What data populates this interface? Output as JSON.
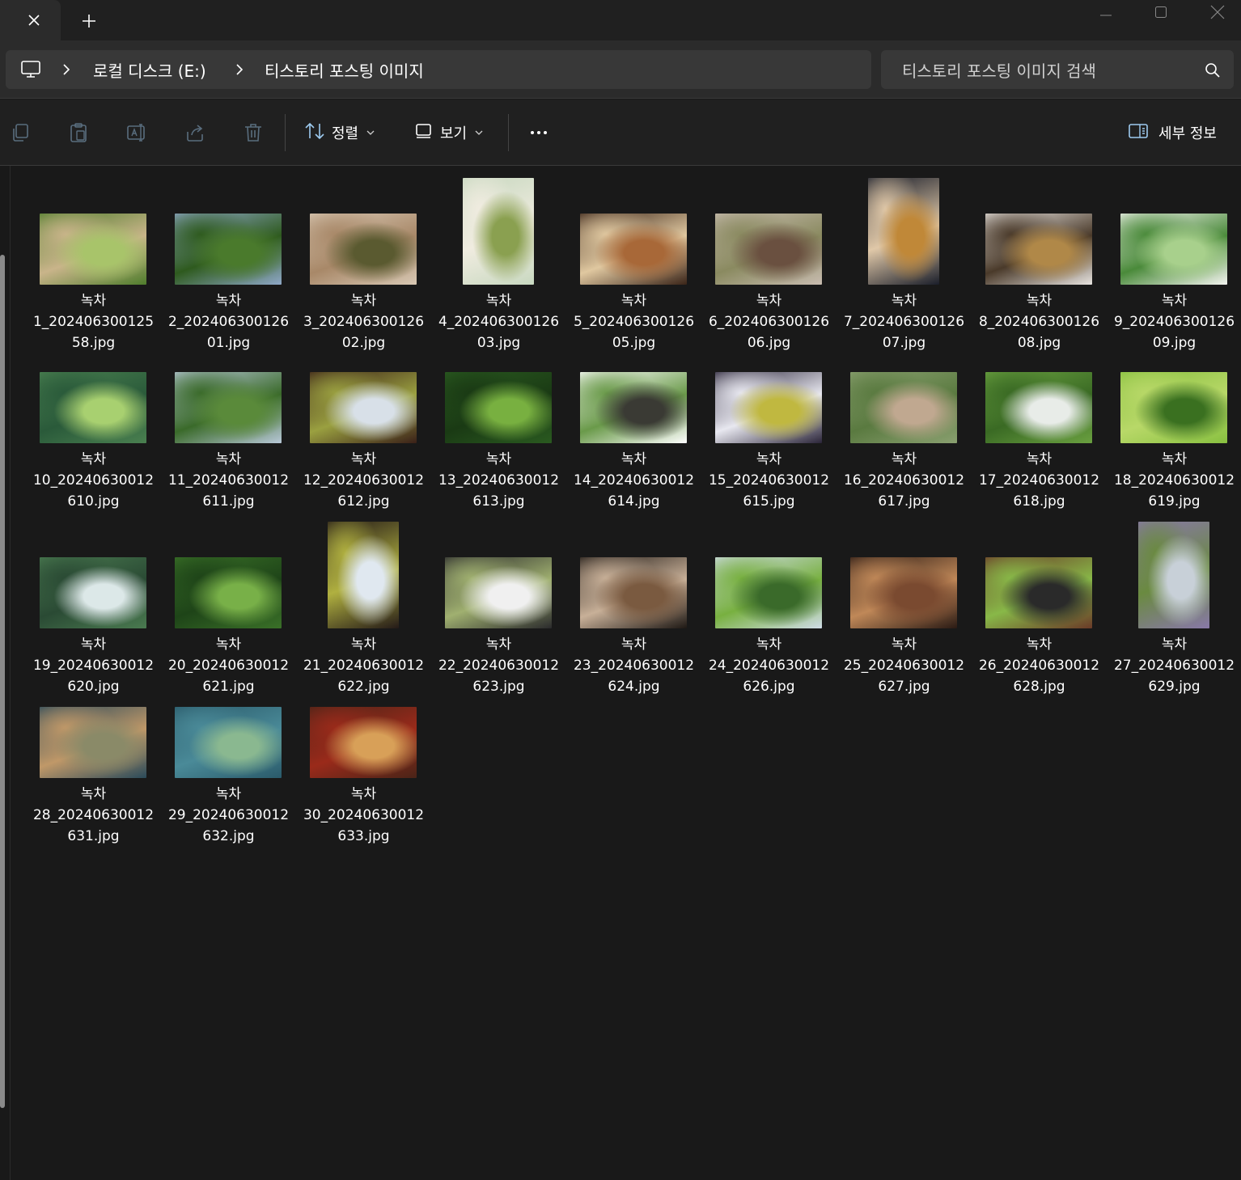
{
  "window": {
    "tab_close_icon": "close-icon",
    "new_tab_icon": "plus-icon",
    "controls": [
      "minimize-icon",
      "maximize-icon",
      "close-icon"
    ]
  },
  "address": {
    "pc_icon": "computer-icon",
    "crumbs": [
      "로컬 디스크 (E:)",
      "티스토리 포스팅 이미지"
    ]
  },
  "search": {
    "placeholder": "티스토리 포스팅 이미지 검색",
    "icon": "search-icon"
  },
  "toolbar": {
    "icons": [
      "copy-icon",
      "paste-icon",
      "rename-icon",
      "share-icon",
      "delete-icon"
    ],
    "sort_label": "정렬",
    "view_label": "보기",
    "more_icon": "more-icon",
    "details_label": "세부 정보"
  },
  "files": [
    {
      "title": "녹차",
      "line1": "1_202406300125",
      "line2": "58.jpg",
      "colors": [
        "#4f7d2c",
        "#a8c46a",
        "#c9b48a"
      ],
      "orient": "landscape"
    },
    {
      "title": "녹차",
      "line1": "2_202406300126",
      "line2": "01.jpg",
      "colors": [
        "#8fa8c8",
        "#4a7a2c",
        "#2e5a1e"
      ],
      "orient": "landscape"
    },
    {
      "title": "녹차",
      "line1": "3_202406300126",
      "line2": "02.jpg",
      "colors": [
        "#d8c8b4",
        "#5a5a30",
        "#a88868"
      ],
      "orient": "landscape"
    },
    {
      "title": "녹차",
      "line1": "4_202406300126",
      "line2": "03.jpg",
      "colors": [
        "#c8d8c0",
        "#8aa050",
        "#f0ece0"
      ],
      "orient": "portrait"
    },
    {
      "title": "녹차",
      "line1": "5_202406300126",
      "line2": "05.jpg",
      "colors": [
        "#3a2418",
        "#a86838",
        "#e0c8a0"
      ],
      "orient": "landscape"
    },
    {
      "title": "녹차",
      "line1": "6_202406300126",
      "line2": "06.jpg",
      "colors": [
        "#c8bcb0",
        "#6a5040",
        "#8a8a60"
      ],
      "orient": "landscape"
    },
    {
      "title": "녹차",
      "line1": "7_202406300126",
      "line2": "07.jpg",
      "colors": [
        "#1a1e2a",
        "#c08838",
        "#e0c8a8"
      ],
      "orient": "portrait"
    },
    {
      "title": "녹차",
      "line1": "8_202406300126",
      "line2": "08.jpg",
      "colors": [
        "#e8e4e0",
        "#b08848",
        "#4a3a2a"
      ],
      "orient": "landscape"
    },
    {
      "title": "녹차",
      "line1": "9_202406300126",
      "line2": "09.jpg",
      "colors": [
        "#f4f4f0",
        "#a8d08c",
        "#4a8a3a"
      ],
      "orient": "landscape"
    },
    {
      "title": "녹차",
      "line1": "10_20240630012",
      "line2": "610.jpg",
      "colors": [
        "#4a8050",
        "#a8d070",
        "#2a5a3a"
      ],
      "orient": "landscape"
    },
    {
      "title": "녹차",
      "line1": "11_20240630012",
      "line2": "611.jpg",
      "colors": [
        "#b8c8d8",
        "#5a8a3a",
        "#3a6a2a"
      ],
      "orient": "landscape"
    },
    {
      "title": "녹차",
      "line1": "12_20240630012",
      "line2": "612.jpg",
      "colors": [
        "#3a2018",
        "#d8e0e8",
        "#9aa040"
      ],
      "orient": "landscape"
    },
    {
      "title": "녹차",
      "line1": "13_20240630012",
      "line2": "613.jpg",
      "colors": [
        "#2a5a20",
        "#78b040",
        "#1a3a14"
      ],
      "orient": "landscape"
    },
    {
      "title": "녹차",
      "line1": "14_20240630012",
      "line2": "614.jpg",
      "colors": [
        "#ffffff",
        "#3a3a34",
        "#6a9a4a"
      ],
      "orient": "landscape"
    },
    {
      "title": "녹차",
      "line1": "15_20240630012",
      "line2": "615.jpg",
      "colors": [
        "#2a2438",
        "#c0b840",
        "#e8e8f0"
      ],
      "orient": "landscape"
    },
    {
      "title": "녹차",
      "line1": "16_20240630012",
      "line2": "617.jpg",
      "colors": [
        "#8aa070",
        "#c0a890",
        "#5a7a40"
      ],
      "orient": "landscape"
    },
    {
      "title": "녹차",
      "line1": "17_20240630012",
      "line2": "618.jpg",
      "colors": [
        "#6aa040",
        "#e8ece8",
        "#3a6a24"
      ],
      "orient": "landscape"
    },
    {
      "title": "녹차",
      "line1": "18_20240630012",
      "line2": "619.jpg",
      "colors": [
        "#88c040",
        "#3a7020",
        "#b8d868"
      ],
      "orient": "landscape"
    },
    {
      "title": "녹차",
      "line1": "19_20240630012",
      "line2": "620.jpg",
      "colors": [
        "#4a7a50",
        "#dce8e8",
        "#2a4a34"
      ],
      "orient": "landscape"
    },
    {
      "title": "녹차",
      "line1": "20_20240630012",
      "line2": "621.jpg",
      "colors": [
        "#3a7028",
        "#78b048",
        "#1e4418"
      ],
      "orient": "landscape"
    },
    {
      "title": "녹차",
      "line1": "21_20240630012",
      "line2": "622.jpg",
      "colors": [
        "#241a18",
        "#e0e8f0",
        "#b0b040"
      ],
      "orient": "portrait"
    },
    {
      "title": "녹차",
      "line1": "22_20240630012",
      "line2": "623.jpg",
      "colors": [
        "#2a2a2c",
        "#f0f0f0",
        "#a0b070"
      ],
      "orient": "landscape"
    },
    {
      "title": "녹차",
      "line1": "23_20240630012",
      "line2": "624.jpg",
      "colors": [
        "#1e1814",
        "#7a5a40",
        "#c8b098"
      ],
      "orient": "landscape"
    },
    {
      "title": "녹차",
      "line1": "24_20240630012",
      "line2": "626.jpg",
      "colors": [
        "#d0dce8",
        "#3a6a2a",
        "#78b040"
      ],
      "orient": "landscape"
    },
    {
      "title": "녹차",
      "line1": "25_20240630012",
      "line2": "627.jpg",
      "colors": [
        "#2a1a14",
        "#7a4a30",
        "#c08858"
      ],
      "orient": "landscape"
    },
    {
      "title": "녹차",
      "line1": "26_20240630012",
      "line2": "628.jpg",
      "colors": [
        "#6a3a28",
        "#2a2a2a",
        "#88b848"
      ],
      "orient": "landscape"
    },
    {
      "title": "녹차",
      "line1": "27_20240630012",
      "line2": "629.jpg",
      "colors": [
        "#8878a8",
        "#c8d0d8",
        "#6a8a40"
      ],
      "orient": "portrait"
    },
    {
      "title": "녹차",
      "line1": "28_20240630012",
      "line2": "631.jpg",
      "colors": [
        "#2a4a5a",
        "#8a8a68",
        "#c09868"
      ],
      "orient": "landscape"
    },
    {
      "title": "녹차",
      "line1": "29_20240630012",
      "line2": "632.jpg",
      "colors": [
        "#2a5a6a",
        "#8ab890",
        "#4a8a98"
      ],
      "orient": "landscape"
    },
    {
      "title": "녹차",
      "line1": "30_20240630012",
      "line2": "633.jpg",
      "colors": [
        "#4a2418",
        "#d8a058",
        "#9a2a1a"
      ],
      "orient": "landscape"
    }
  ]
}
